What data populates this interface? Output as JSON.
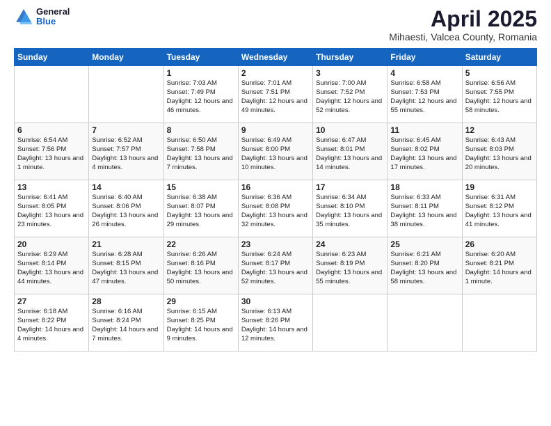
{
  "logo": {
    "general": "General",
    "blue": "Blue"
  },
  "header": {
    "title": "April 2025",
    "location": "Mihaesti, Valcea County, Romania"
  },
  "days_of_week": [
    "Sunday",
    "Monday",
    "Tuesday",
    "Wednesday",
    "Thursday",
    "Friday",
    "Saturday"
  ],
  "weeks": [
    [
      {
        "day": "",
        "info": ""
      },
      {
        "day": "",
        "info": ""
      },
      {
        "day": "1",
        "info": "Sunrise: 7:03 AM\nSunset: 7:49 PM\nDaylight: 12 hours\nand 46 minutes."
      },
      {
        "day": "2",
        "info": "Sunrise: 7:01 AM\nSunset: 7:51 PM\nDaylight: 12 hours\nand 49 minutes."
      },
      {
        "day": "3",
        "info": "Sunrise: 7:00 AM\nSunset: 7:52 PM\nDaylight: 12 hours\nand 52 minutes."
      },
      {
        "day": "4",
        "info": "Sunrise: 6:58 AM\nSunset: 7:53 PM\nDaylight: 12 hours\nand 55 minutes."
      },
      {
        "day": "5",
        "info": "Sunrise: 6:56 AM\nSunset: 7:55 PM\nDaylight: 12 hours\nand 58 minutes."
      }
    ],
    [
      {
        "day": "6",
        "info": "Sunrise: 6:54 AM\nSunset: 7:56 PM\nDaylight: 13 hours\nand 1 minute."
      },
      {
        "day": "7",
        "info": "Sunrise: 6:52 AM\nSunset: 7:57 PM\nDaylight: 13 hours\nand 4 minutes."
      },
      {
        "day": "8",
        "info": "Sunrise: 6:50 AM\nSunset: 7:58 PM\nDaylight: 13 hours\nand 7 minutes."
      },
      {
        "day": "9",
        "info": "Sunrise: 6:49 AM\nSunset: 8:00 PM\nDaylight: 13 hours\nand 10 minutes."
      },
      {
        "day": "10",
        "info": "Sunrise: 6:47 AM\nSunset: 8:01 PM\nDaylight: 13 hours\nand 14 minutes."
      },
      {
        "day": "11",
        "info": "Sunrise: 6:45 AM\nSunset: 8:02 PM\nDaylight: 13 hours\nand 17 minutes."
      },
      {
        "day": "12",
        "info": "Sunrise: 6:43 AM\nSunset: 8:03 PM\nDaylight: 13 hours\nand 20 minutes."
      }
    ],
    [
      {
        "day": "13",
        "info": "Sunrise: 6:41 AM\nSunset: 8:05 PM\nDaylight: 13 hours\nand 23 minutes."
      },
      {
        "day": "14",
        "info": "Sunrise: 6:40 AM\nSunset: 8:06 PM\nDaylight: 13 hours\nand 26 minutes."
      },
      {
        "day": "15",
        "info": "Sunrise: 6:38 AM\nSunset: 8:07 PM\nDaylight: 13 hours\nand 29 minutes."
      },
      {
        "day": "16",
        "info": "Sunrise: 6:36 AM\nSunset: 8:08 PM\nDaylight: 13 hours\nand 32 minutes."
      },
      {
        "day": "17",
        "info": "Sunrise: 6:34 AM\nSunset: 8:10 PM\nDaylight: 13 hours\nand 35 minutes."
      },
      {
        "day": "18",
        "info": "Sunrise: 6:33 AM\nSunset: 8:11 PM\nDaylight: 13 hours\nand 38 minutes."
      },
      {
        "day": "19",
        "info": "Sunrise: 6:31 AM\nSunset: 8:12 PM\nDaylight: 13 hours\nand 41 minutes."
      }
    ],
    [
      {
        "day": "20",
        "info": "Sunrise: 6:29 AM\nSunset: 8:14 PM\nDaylight: 13 hours\nand 44 minutes."
      },
      {
        "day": "21",
        "info": "Sunrise: 6:28 AM\nSunset: 8:15 PM\nDaylight: 13 hours\nand 47 minutes."
      },
      {
        "day": "22",
        "info": "Sunrise: 6:26 AM\nSunset: 8:16 PM\nDaylight: 13 hours\nand 50 minutes."
      },
      {
        "day": "23",
        "info": "Sunrise: 6:24 AM\nSunset: 8:17 PM\nDaylight: 13 hours\nand 52 minutes."
      },
      {
        "day": "24",
        "info": "Sunrise: 6:23 AM\nSunset: 8:19 PM\nDaylight: 13 hours\nand 55 minutes."
      },
      {
        "day": "25",
        "info": "Sunrise: 6:21 AM\nSunset: 8:20 PM\nDaylight: 13 hours\nand 58 minutes."
      },
      {
        "day": "26",
        "info": "Sunrise: 6:20 AM\nSunset: 8:21 PM\nDaylight: 14 hours\nand 1 minute."
      }
    ],
    [
      {
        "day": "27",
        "info": "Sunrise: 6:18 AM\nSunset: 8:22 PM\nDaylight: 14 hours\nand 4 minutes."
      },
      {
        "day": "28",
        "info": "Sunrise: 6:16 AM\nSunset: 8:24 PM\nDaylight: 14 hours\nand 7 minutes."
      },
      {
        "day": "29",
        "info": "Sunrise: 6:15 AM\nSunset: 8:25 PM\nDaylight: 14 hours\nand 9 minutes."
      },
      {
        "day": "30",
        "info": "Sunrise: 6:13 AM\nSunset: 8:26 PM\nDaylight: 14 hours\nand 12 minutes."
      },
      {
        "day": "",
        "info": ""
      },
      {
        "day": "",
        "info": ""
      },
      {
        "day": "",
        "info": ""
      }
    ]
  ]
}
